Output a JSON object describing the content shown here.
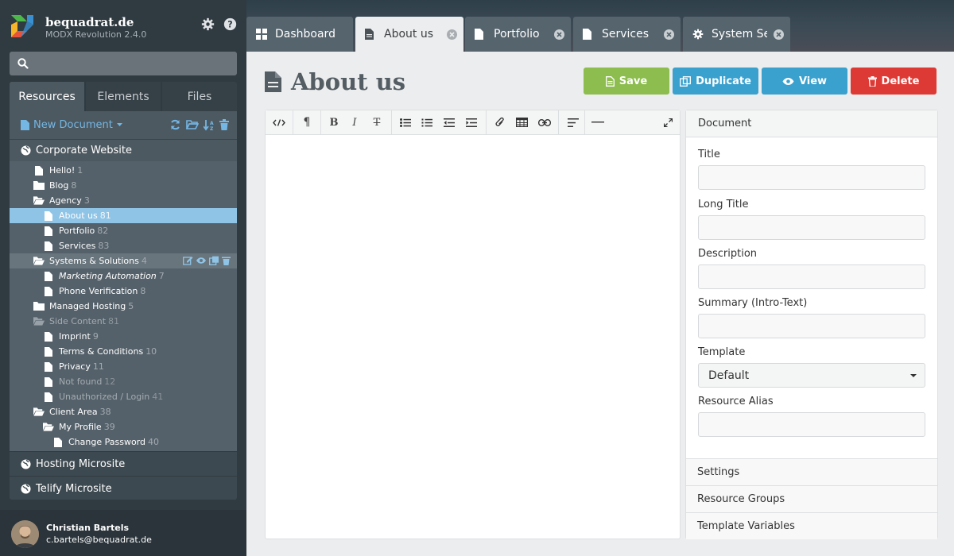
{
  "brand": {
    "name": "bequadrat.de",
    "version": "MODX Revolution 2.4.0"
  },
  "sidebar": {
    "tabs": [
      {
        "label": "Resources"
      },
      {
        "label": "Elements"
      },
      {
        "label": "Files"
      }
    ],
    "new_document": "New Document",
    "context_main": "Corporate Website",
    "tree": [
      {
        "label": "Hello!",
        "id": "1"
      },
      {
        "label": "Blog",
        "id": "8"
      },
      {
        "label": "Agency",
        "id": "3"
      },
      {
        "label": "About us",
        "id": "81"
      },
      {
        "label": "Portfolio",
        "id": "82"
      },
      {
        "label": "Services",
        "id": "83"
      },
      {
        "label": "Systems & Solutions",
        "id": "4"
      },
      {
        "label": "Marketing Automation",
        "id": "7"
      },
      {
        "label": "Phone Verification",
        "id": "8"
      },
      {
        "label": "Managed Hosting",
        "id": "5"
      },
      {
        "label": "Side Content",
        "id": "81"
      },
      {
        "label": "Imprint",
        "id": "9"
      },
      {
        "label": "Terms & Conditions",
        "id": "10"
      },
      {
        "label": "Privacy",
        "id": "11"
      },
      {
        "label": "Not found",
        "id": "12"
      },
      {
        "label": "Unauthorized / Login",
        "id": "41"
      },
      {
        "label": "Client Area",
        "id": "38"
      },
      {
        "label": "My Profile",
        "id": "39"
      },
      {
        "label": "Change Password",
        "id": "40"
      }
    ],
    "contexts": [
      {
        "label": "Hosting Microsite"
      },
      {
        "label": "Telify Microsite"
      }
    ]
  },
  "user": {
    "name": "Christian Bartels",
    "email": "c.bartels@bequadrat.de"
  },
  "tabs": [
    {
      "label": "Dashboard"
    },
    {
      "label": "About us"
    },
    {
      "label": "Portfolio"
    },
    {
      "label": "Services"
    },
    {
      "label": "System Settings"
    }
  ],
  "page": {
    "title": "About us"
  },
  "actions": {
    "save": "Save",
    "duplicate": "Duplicate",
    "view": "View",
    "delete": "Delete"
  },
  "document_panel": {
    "heading": "Document",
    "fields": {
      "title": {
        "label": "Title",
        "value": ""
      },
      "long_title": {
        "label": "Long Title",
        "value": ""
      },
      "description": {
        "label": "Description",
        "value": ""
      },
      "summary": {
        "label": "Summary (Intro-Text)",
        "value": ""
      },
      "template": {
        "label": "Template",
        "value": "Default"
      },
      "alias": {
        "label": "Resource Alias",
        "value": ""
      }
    },
    "sections": [
      {
        "label": "Settings"
      },
      {
        "label": "Resource Groups"
      },
      {
        "label": "Template Variables"
      }
    ]
  },
  "colors": {
    "save": "#8cbd4e",
    "duplicate": "#3aa0cd",
    "view": "#3aa0cd",
    "delete": "#de3a35",
    "selected_node": "#8fc4e6",
    "accent": "#74b6e4"
  }
}
